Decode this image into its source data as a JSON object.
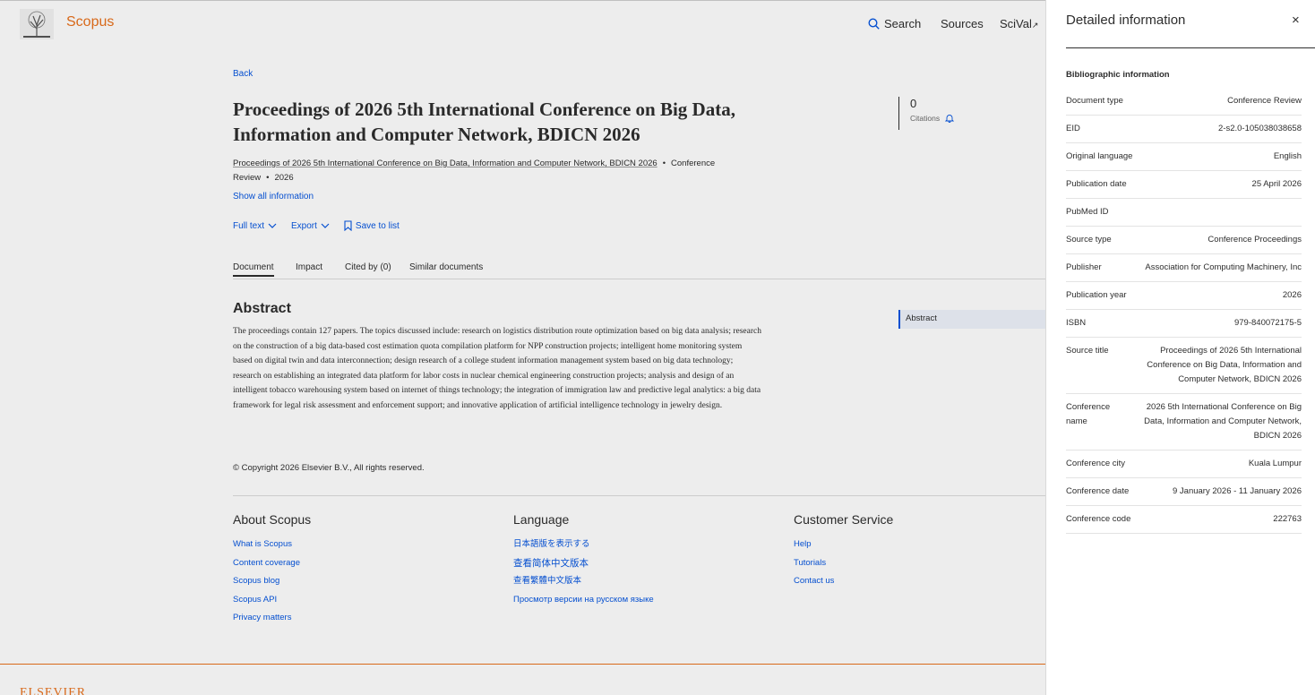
{
  "header": {
    "brand": "Scopus",
    "nav": {
      "search": "Search",
      "sources": "Sources",
      "scival": "SciVal"
    }
  },
  "doc": {
    "back": "Back",
    "title": "Proceedings of 2026 5th International Conference on Big Data, Information and Computer Network, BDICN 2026",
    "meta_source": "Proceedings of 2026 5th International Conference on Big Data, Information and Computer Network, BDICN 2026",
    "meta_type": "Conference Review",
    "meta_year": "2026",
    "show_all": "Show all information",
    "actions": {
      "full_text": "Full text",
      "export": "Export",
      "save": "Save to list"
    },
    "citations": {
      "count": "0",
      "label": "Citations"
    }
  },
  "tabs": [
    "Document",
    "Impact",
    "Cited by (0)",
    "Similar documents"
  ],
  "abstract": {
    "heading": "Abstract",
    "text": "The proceedings contain 127 papers. The topics discussed include: research on logistics distribution route optimization based on big data analysis; research on the construction of a big data-based cost estimation quota compilation platform for NPP construction projects; intelligent home monitoring system based on digital twin and data interconnection; design research of a college student information management system based on big data technology; research on establishing an integrated data platform for labor costs in nuclear chemical engineering construction projects; analysis and design of an intelligent tobacco warehousing system based on internet of things technology; the integration of immigration law and predictive legal analytics: a big data framework for legal risk assessment and enforcement support; and innovative application of artificial intelligence technology in jewelry design.",
    "toc_label": "Abstract",
    "copyright": "© Copyright 2026 Elsevier B.V., All rights reserved."
  },
  "footer": {
    "about": {
      "heading": "About Scopus",
      "links": [
        "What is Scopus",
        "Content coverage",
        "Scopus blog",
        "Scopus API",
        "Privacy matters"
      ]
    },
    "language": {
      "heading": "Language",
      "links": [
        "日本語版を表示する",
        "查看简体中文版本",
        "查看繁體中文版本",
        "Просмотр версии на русском языке"
      ]
    },
    "service": {
      "heading": "Customer Service",
      "links": [
        "Help",
        "Tutorials",
        "Contact us"
      ]
    },
    "elsevier": "ELSEVIER"
  },
  "panel": {
    "title": "Detailed information",
    "close": "×",
    "subtitle": "Bibliographic information",
    "rows": [
      {
        "k": "Document type",
        "v": "Conference Review"
      },
      {
        "k": "EID",
        "v": "2-s2.0-105038038658"
      },
      {
        "k": "Original language",
        "v": "English"
      },
      {
        "k": "Publication date",
        "v": "25 April 2026"
      },
      {
        "k": "PubMed ID",
        "v": ""
      },
      {
        "k": "Source type",
        "v": "Conference Proceedings"
      },
      {
        "k": "Publisher",
        "v": "Association for Computing Machinery, Inc"
      },
      {
        "k": "Publication year",
        "v": "2026"
      },
      {
        "k": "ISBN",
        "v": "979-840072175-5"
      },
      {
        "k": "Source title",
        "v": "Proceedings of 2026 5th International Conference on Big Data, Information and Computer Network, BDICN 2026"
      },
      {
        "k": "Conference name",
        "v": "2026 5th International Conference on Big Data, Information and Computer Network, BDICN 2026"
      },
      {
        "k": "Conference city",
        "v": "Kuala Lumpur"
      },
      {
        "k": "Conference date",
        "v": "9 January 2026 - 11 January 2026"
      },
      {
        "k": "Conference code",
        "v": "222763"
      }
    ]
  }
}
